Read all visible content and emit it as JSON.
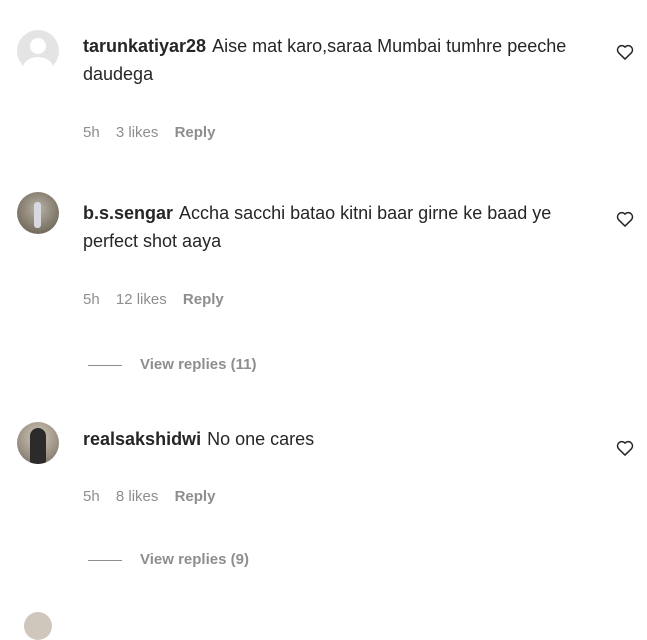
{
  "comments": [
    {
      "username": "tarunkatiyar28",
      "text": "Aise mat karo,saraa Mumbai tumhre peeche daudega",
      "time": "5h",
      "likes": "3 likes",
      "reply": "Reply",
      "view_replies": null,
      "avatar_icon": "default-avatar-icon"
    },
    {
      "username": "b.s.sengar",
      "text": "Accha sacchi batao kitni baar girne ke baad ye perfect shot aaya",
      "time": "5h",
      "likes": "12 likes",
      "reply": "Reply",
      "view_replies": "View replies (11)",
      "avatar_icon": "user-photo-icon"
    },
    {
      "username": "realsakshidwi",
      "text": "No one cares",
      "time": "5h",
      "likes": "8 likes",
      "reply": "Reply",
      "view_replies": "View replies (9)",
      "avatar_icon": "user-photo-icon"
    }
  ],
  "icons": {
    "like": "heart-outline-icon"
  },
  "colors": {
    "text": "#262626",
    "secondary": "#8e8e8e"
  }
}
